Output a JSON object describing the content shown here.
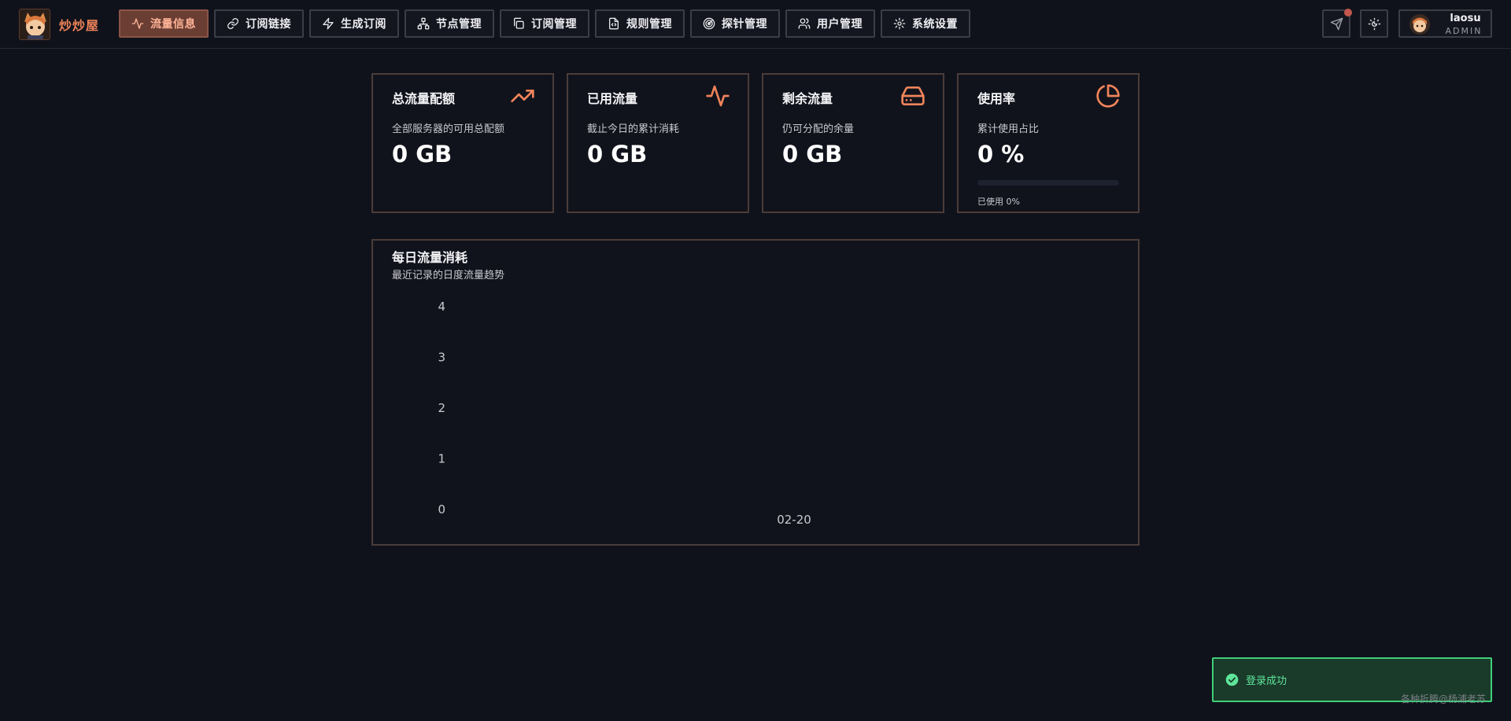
{
  "header": {
    "brand": "炒炒屋",
    "nav": [
      {
        "label": "流量信息",
        "icon": "activity-icon",
        "active": true
      },
      {
        "label": "订阅链接",
        "icon": "link-icon"
      },
      {
        "label": "生成订阅",
        "icon": "zap-icon"
      },
      {
        "label": "节点管理",
        "icon": "network-icon"
      },
      {
        "label": "订阅管理",
        "icon": "copy-icon"
      },
      {
        "label": "规则管理",
        "icon": "file-code-icon"
      },
      {
        "label": "探针管理",
        "icon": "radar-icon"
      },
      {
        "label": "用户管理",
        "icon": "users-icon"
      },
      {
        "label": "系统设置",
        "icon": "gear-icon"
      }
    ],
    "user": {
      "name": "laosu",
      "role": "ADMIN"
    }
  },
  "stats": [
    {
      "title": "总流量配额",
      "desc": "全部服务器的可用总配额",
      "value": "0 GB",
      "icon": "trending-up-icon"
    },
    {
      "title": "已用流量",
      "desc": "截止今日的累计消耗",
      "value": "0 GB",
      "icon": "activity-icon"
    },
    {
      "title": "剩余流量",
      "desc": "仍可分配的余量",
      "value": "0 GB",
      "icon": "hard-drive-icon"
    },
    {
      "title": "使用率",
      "desc": "累计使用占比",
      "value": "0 %",
      "icon": "pie-chart-icon",
      "progress": 0,
      "progress_text": "已使用 0%"
    }
  ],
  "chart_panel": {
    "title": "每日流量消耗",
    "subtitle": "最近记录的日度流量趋势"
  },
  "chart_data": {
    "type": "line",
    "x": [
      "02-20"
    ],
    "series": [
      {
        "values": [
          0
        ]
      }
    ],
    "yticks": [
      0,
      1,
      2,
      3,
      4
    ],
    "ylim": [
      0,
      4
    ],
    "grid": false
  },
  "toast": {
    "text": "登录成功"
  },
  "watermark": "各种折腾@杨浦老苏",
  "colors": {
    "accent": "#f0845a",
    "success": "#3fcf7a",
    "background": "#10121b"
  }
}
